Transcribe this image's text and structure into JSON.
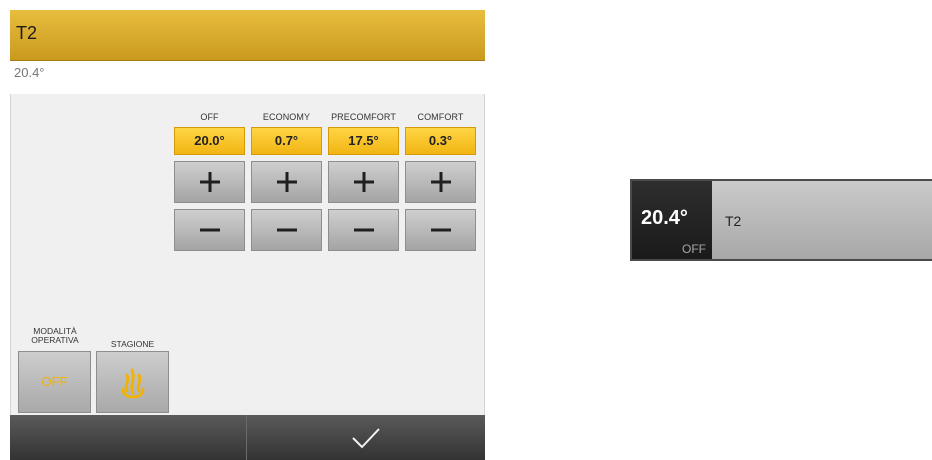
{
  "panel": {
    "title": "T2",
    "current_temperature": "20.4°",
    "setpoints": [
      {
        "label": "OFF",
        "value": "20.0°"
      },
      {
        "label": "ECONOMY",
        "value": "0.7°"
      },
      {
        "label": "PRECOMFORT",
        "value": "17.5°"
      },
      {
        "label": "COMFORT",
        "value": "0.3°"
      }
    ],
    "mode": {
      "label_line1": "MODALITÀ",
      "label_line2": "OPERATIVA",
      "value": "OFF"
    },
    "season": {
      "label": "STAGIONE",
      "icon": "flame-icon"
    },
    "footer": {
      "confirm_icon": "checkmark-icon"
    },
    "colors": {
      "header": "#d9a92c",
      "setpoint": "#f7c520",
      "accent_text": "#f2b200"
    }
  },
  "widget": {
    "temperature": "20.4°",
    "state": "OFF",
    "name": "T2"
  }
}
